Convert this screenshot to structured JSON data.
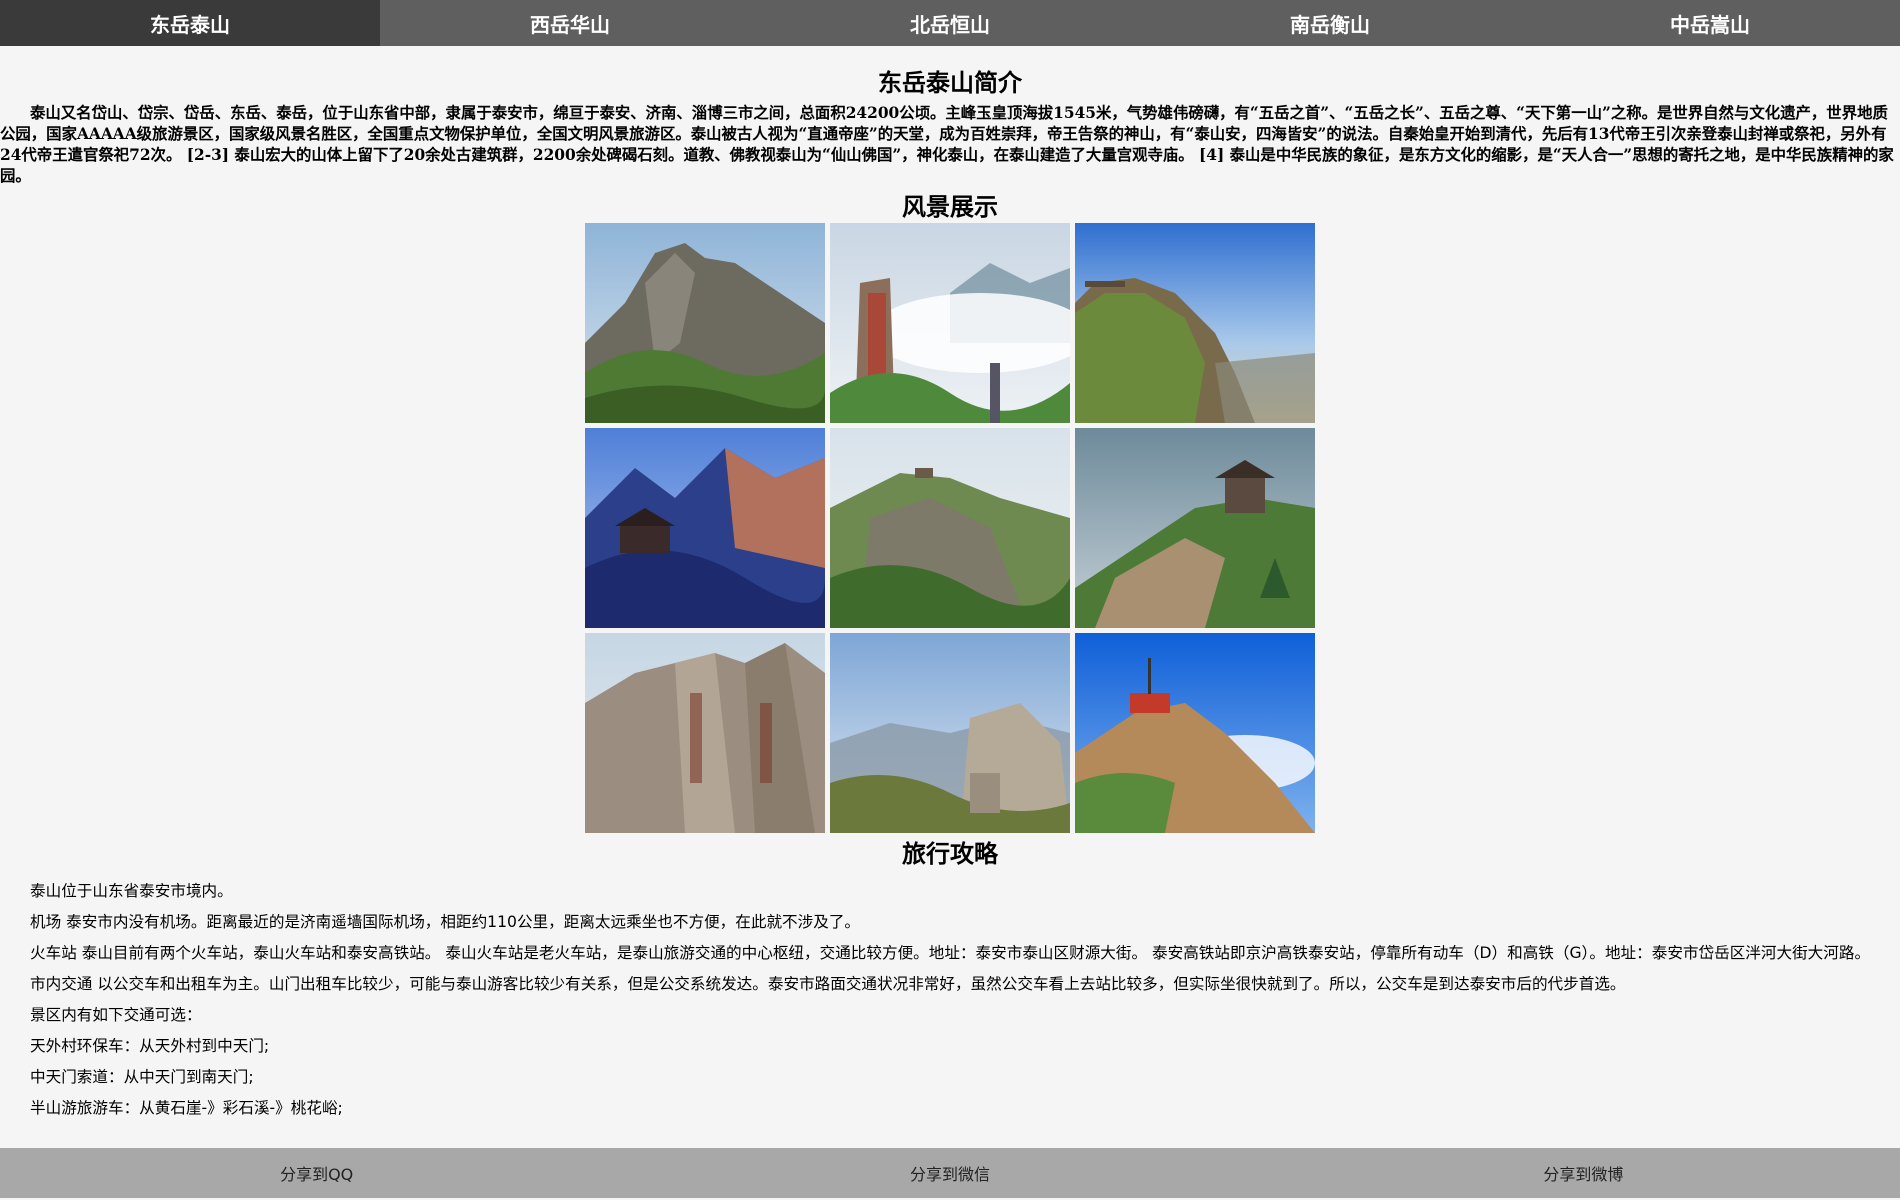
{
  "nav": {
    "tabs": [
      {
        "label": "东岳泰山",
        "active": true
      },
      {
        "label": "西岳华山",
        "active": false
      },
      {
        "label": "北岳恒山",
        "active": false
      },
      {
        "label": "南岳衡山",
        "active": false
      },
      {
        "label": "中岳嵩山",
        "active": false
      }
    ]
  },
  "intro": {
    "title": "东岳泰山简介",
    "text": "泰山又名岱山、岱宗、岱岳、东岳、泰岳，位于山东省中部，隶属于泰安市，绵亘于泰安、济南、淄博三市之间，总面积24200公顷。主峰玉皇顶海拔1545米，气势雄伟磅礴，有“五岳之首”、“五岳之长”、五岳之尊、“天下第一山”之称。是世界自然与文化遗产，世界地质公园，国家AAAAA级旅游景区，国家级风景名胜区，全国重点文物保护单位，全国文明风景旅游区。泰山被古人视为“直通帝座”的天堂，成为百姓崇拜，帝王告祭的神山，有“泰山安，四海皆安”的说法。自秦始皇开始到清代，先后有13代帝王引次亲登泰山封禅或祭祀，另外有24代帝王遣官祭祀72次。 [2-3] 泰山宏大的山体上留下了20余处古建筑群，2200余处碑碣石刻。道教、佛教视泰山为“仙山佛国”，神化泰山，在泰山建造了大量宫观寺庙。 [4] 泰山是中华民族的象征，是东方文化的缩影，是“天人合一”思想的寄托之地，是中华民族精神的家园。"
  },
  "gallery": {
    "title": "风景展示",
    "photos": [
      {
        "scene": "rocky-peak"
      },
      {
        "scene": "clouds-inscribed-rock"
      },
      {
        "scene": "summit-overlook"
      },
      {
        "scene": "temple-blue-mountains"
      },
      {
        "scene": "green-ridge-temple"
      },
      {
        "scene": "gate-on-ridge"
      },
      {
        "scene": "carved-cliffs"
      },
      {
        "scene": "rock-outcrop"
      },
      {
        "scene": "station-blue-sky"
      }
    ]
  },
  "guide": {
    "title": "旅行攻略",
    "paragraphs": [
      "泰山位于山东省泰安市境内。",
      "机场 泰安市内没有机场。距离最近的是济南遥墙国际机场，相距约110公里，距离太远乘坐也不方便，在此就不涉及了。",
      "火车站 泰山目前有两个火车站，泰山火车站和泰安高铁站。 泰山火车站是老火车站，是泰山旅游交通的中心枢纽，交通比较方便。地址：泰安市泰山区财源大街。 泰安高铁站即京沪高铁泰安站，停靠所有动车（D）和高铁（G）。地址：泰安市岱岳区泮河大街大河路。",
      "市内交通 以公交车和出租车为主。山门出租车比较少，可能与泰山游客比较少有关系，但是公交系统发达。泰安市路面交通状况非常好，虽然公交车看上去站比较多，但实际坐很快就到了。所以，公交车是到达泰安市后的代步首选。",
      "景区内有如下交通可选：",
      "天外村环保车：从天外村到中天门;",
      "中天门索道：从中天门到南天门;",
      "半山游旅游车：从黄石崖-》彩石溪-》桃花峪;"
    ]
  },
  "footer": {
    "share_qq": "分享到QQ",
    "share_wechat": "分享到微信",
    "share_weibo": "分享到微博"
  }
}
